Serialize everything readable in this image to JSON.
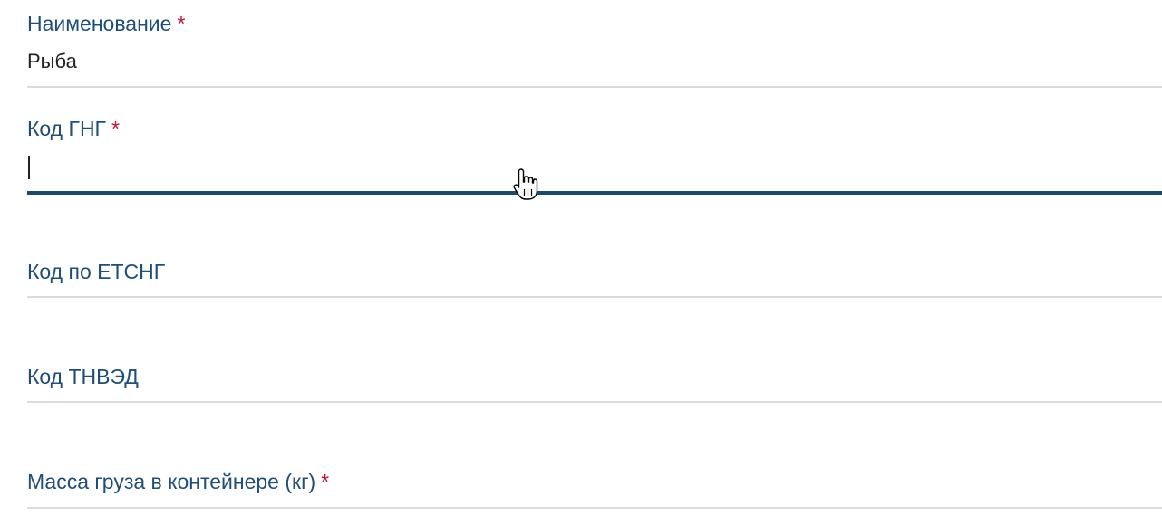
{
  "form": {
    "fields": [
      {
        "label": "Наименование",
        "required_mark": "*",
        "value": "Рыба"
      },
      {
        "label": "Код ГНГ",
        "required_mark": "*",
        "value": ""
      },
      {
        "label": "Код по ЕТСНГ",
        "value": ""
      },
      {
        "label": "Код ТНВЭД",
        "value": ""
      },
      {
        "label": "Масса груза в контейнере (кг)",
        "required_mark": "*",
        "value": ""
      }
    ]
  },
  "colors": {
    "label": "#1f4e79",
    "required": "#c8102e",
    "active_underline": "#1a4a72",
    "underline": "#dcdcdc"
  },
  "icons": {
    "cursor": "hand-pointer-icon"
  }
}
